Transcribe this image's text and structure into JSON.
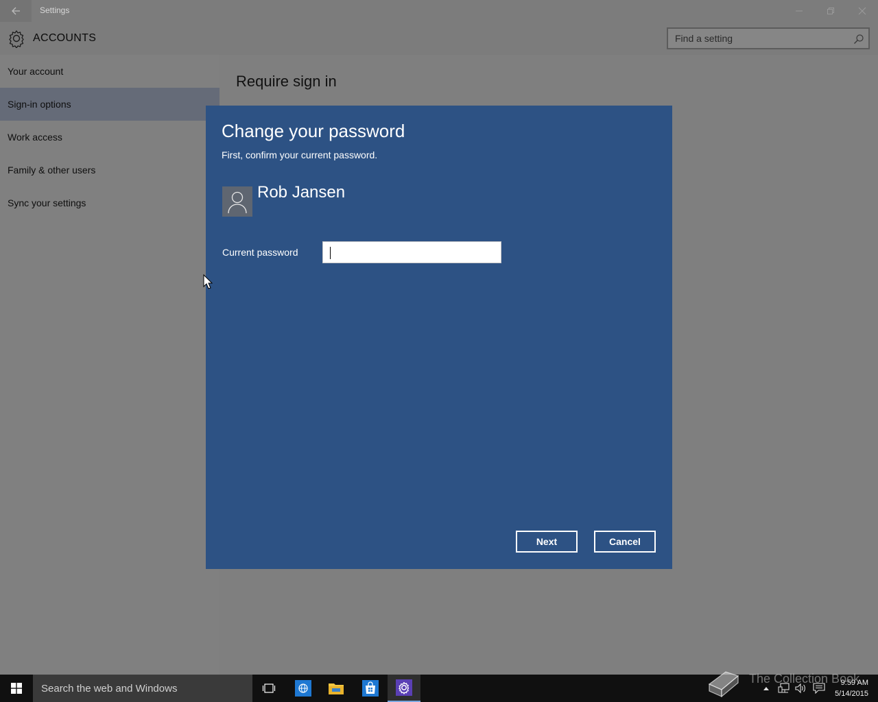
{
  "window": {
    "title": "Settings",
    "header_title": "ACCOUNTS"
  },
  "search": {
    "placeholder": "Find a setting"
  },
  "sidebar": {
    "items": [
      {
        "label": "Your account",
        "active": false
      },
      {
        "label": "Sign-in options",
        "active": true
      },
      {
        "label": "Work access",
        "active": false
      },
      {
        "label": "Family & other users",
        "active": false
      },
      {
        "label": "Sync your settings",
        "active": false
      }
    ]
  },
  "content": {
    "section_title": "Require sign in"
  },
  "dialog": {
    "title": "Change your password",
    "subtitle": "First, confirm your current password.",
    "user_name": "Rob Jansen",
    "password_label": "Current password",
    "password_value": "",
    "next_label": "Next",
    "cancel_label": "Cancel"
  },
  "taskbar": {
    "search_placeholder": "Search the web and Windows",
    "pinned": [
      "task-view-icon",
      "browser-icon",
      "file-explorer-icon",
      "store-icon",
      "settings-icon"
    ]
  },
  "clock": {
    "time": "9:59 AM",
    "date": "5/14/2015"
  },
  "watermark": {
    "text": "The Collection Book"
  },
  "colors": {
    "dialog_bg": "#2d5284",
    "selected_nav": "#656b78",
    "window_dim": "#808080",
    "taskbar": "#101010"
  }
}
